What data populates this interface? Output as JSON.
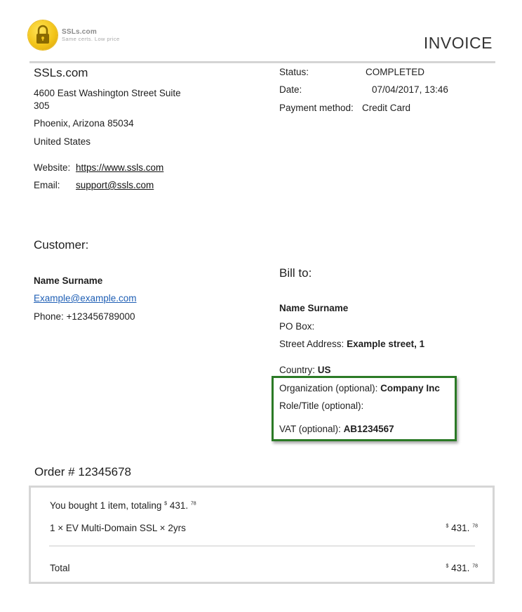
{
  "logo": {
    "name": "SSLs.com",
    "tagline": "Same certs. Low price"
  },
  "header": {
    "title": "INVOICE"
  },
  "seller": {
    "company": "SSLs.com",
    "address_line1": "4600 East Washington Street Suite",
    "address_line2": "305",
    "city_line": "Phoenix, Arizona 85034",
    "country": "United States",
    "website_label": "Website:",
    "website": "https://www.ssls.com",
    "email_label": "Email:",
    "email": "support@ssls.com"
  },
  "status": {
    "status_label": "Status:",
    "status_value": "COMPLETED",
    "date_label": "Date:",
    "date_value": "07/04/2017, 13:46",
    "payment_label": "Payment method:",
    "payment_value": "Credit Card"
  },
  "customer": {
    "heading": "Customer:",
    "name": "Name Surname",
    "email": "Example@example.com",
    "phone": "Phone: +123456789000"
  },
  "bill_to": {
    "heading": "Bill to:",
    "name": "Name Surname",
    "po_box": "PO Box:",
    "street_label": "Street Address:",
    "street_value": "Example street, 1",
    "country_label": "Country:",
    "country_value": "US",
    "org_label": "Organization (optional):",
    "org_value": "Company Inc",
    "role_label": "Role/Title (optional):",
    "vat_label": "VAT (optional):",
    "vat_value": "AB1234567"
  },
  "order": {
    "label": "Order #",
    "number": "12345678",
    "summary_prefix": "You bought 1 item, totaling",
    "currency": "$",
    "summary_amount": "431.",
    "summary_cents": "78",
    "item": "1 × EV Multi-Domain SSL × 2yrs",
    "item_amount": "431.",
    "item_cents": "78",
    "total_label": "Total",
    "total_amount": "431.",
    "total_cents": "78"
  }
}
